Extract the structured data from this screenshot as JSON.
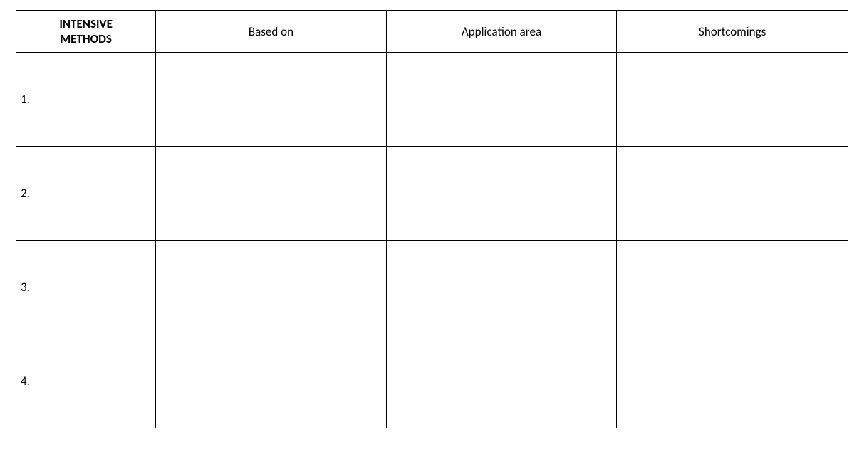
{
  "table": {
    "headers": [
      "INTENSIVE METHODS",
      "Based on",
      "Application area",
      "Shortcomings"
    ],
    "rows": [
      {
        "num": "1.",
        "based_on": "",
        "application_area": "",
        "shortcomings": ""
      },
      {
        "num": "2.",
        "based_on": "",
        "application_area": "",
        "shortcomings": ""
      },
      {
        "num": "3.",
        "based_on": "",
        "application_area": "",
        "shortcomings": ""
      },
      {
        "num": "4.",
        "based_on": "",
        "application_area": "",
        "shortcomings": ""
      }
    ]
  }
}
